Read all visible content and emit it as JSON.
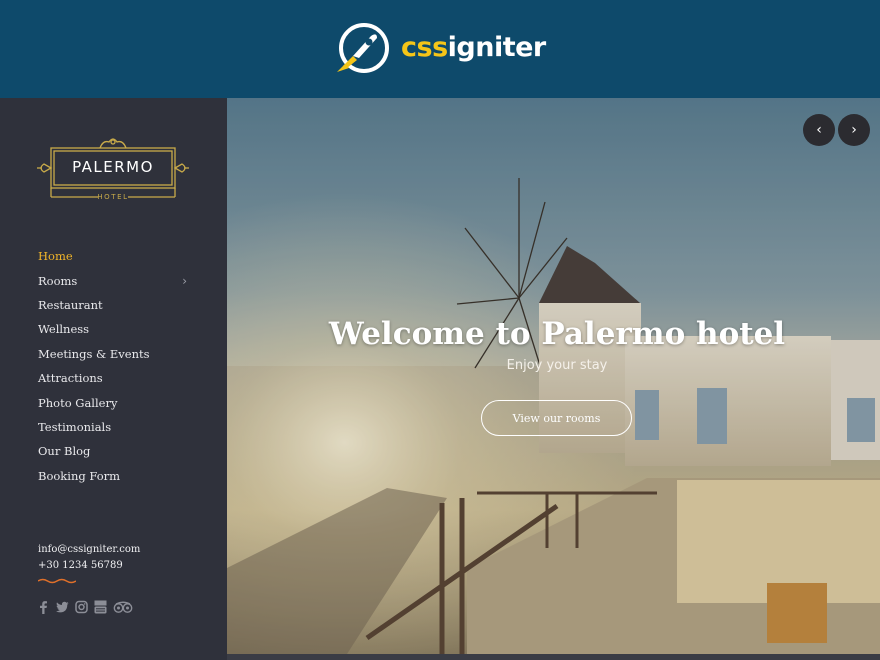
{
  "banner": {
    "brand_part1": "css",
    "brand_part2": "igniter",
    "logo_icon": "rocket-icon"
  },
  "sidebar": {
    "logo": {
      "name": "PALERMO",
      "subtitle": "HOTEL"
    },
    "nav": [
      {
        "label": "Home",
        "active": true
      },
      {
        "label": "Rooms",
        "has_submenu": true,
        "chevron": "›"
      },
      {
        "label": "Restaurant"
      },
      {
        "label": "Wellness"
      },
      {
        "label": "Meetings & Events"
      },
      {
        "label": "Attractions"
      },
      {
        "label": "Photo Gallery"
      },
      {
        "label": "Testimonials"
      },
      {
        "label": "Our Blog"
      },
      {
        "label": "Booking Form"
      }
    ],
    "contact": {
      "email": "info@cssigniter.com",
      "phone": "+30 1234 56789"
    },
    "social_icons": [
      "facebook-icon",
      "twitter-icon",
      "instagram-icon",
      "youtube-icon",
      "tripadvisor-icon"
    ]
  },
  "hero": {
    "title": "Welcome to Palermo hotel",
    "subtitle": "Enjoy your stay",
    "cta_label": "View our rooms",
    "prev_arrow": "‹",
    "next_arrow": "›"
  },
  "colors": {
    "banner_bg": "#0e4a6b",
    "brand_accent": "#f5c518",
    "sidebar_bg": "#2f313b",
    "active_nav": "#f0b429",
    "gold_logo": "#c9ab4a",
    "squiggle": "#e0702a"
  }
}
